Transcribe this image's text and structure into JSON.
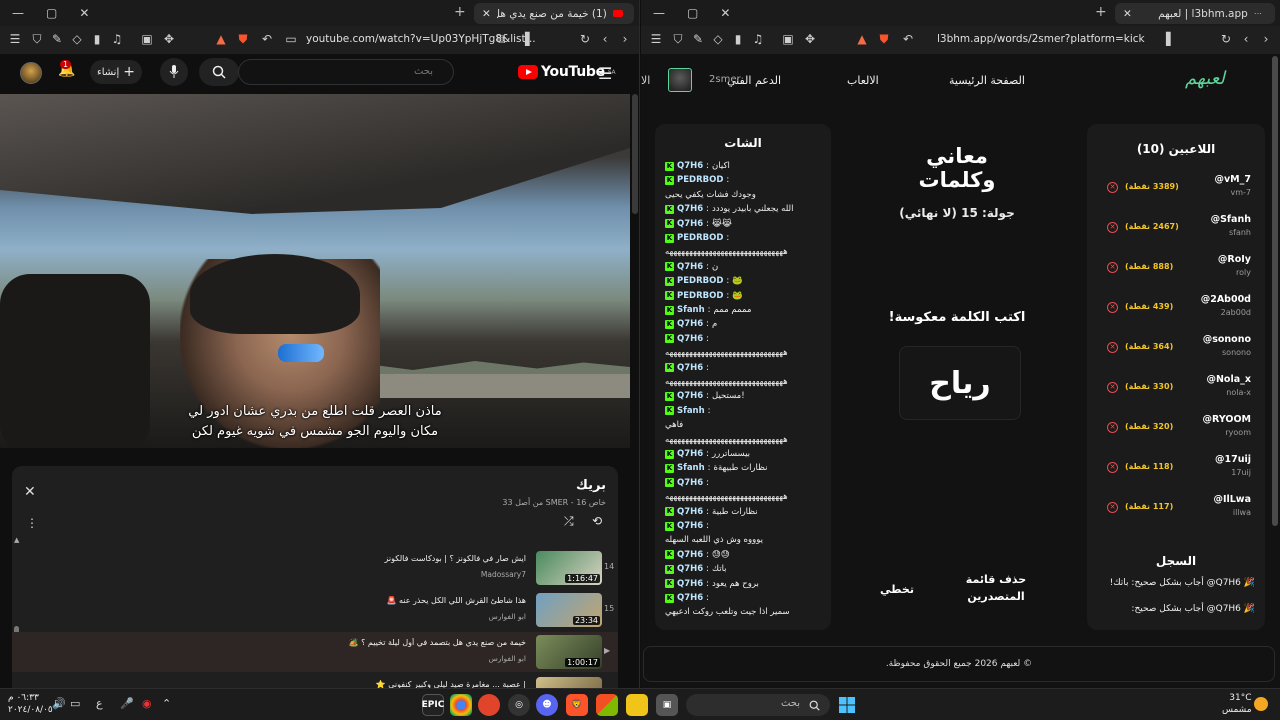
{
  "left_window": {
    "tab_title": "(1) خيمة من صنع يدي هل بتصـ...",
    "url": "youtube.com/watch?v=Up03YpHjTg8&list...",
    "youtube": {
      "logo_text": "YouTube",
      "logo_region": "SA",
      "search_placeholder": "بحث",
      "create_label": "إنشاء",
      "notification_count": "1"
    },
    "subtitles": [
      "ماذن العصر قلت اطلع من بدري عشان ادور لي",
      "مكان واليوم الجو مشمس في شويه غيوم لكن"
    ],
    "playlist": {
      "title": "بريك",
      "subtitle": "خاص SMER - 16 من أصل 33",
      "items": [
        {
          "num": "14",
          "title": "ايش صار في فالكونز ؟ | بودكاست فالكونز",
          "channel": "Madossary7",
          "duration": "1:16:47",
          "active": false
        },
        {
          "num": "15",
          "title": "هذا شاطئ القرش اللي الكل يحذر عنه 🚨",
          "channel": "ابو الفوارس",
          "duration": "23:34",
          "active": false
        },
        {
          "num": "▶",
          "title": "خيمة من صنع يدي هل بتصمد في أول ليلة تخييم ؟ 🏕️",
          "channel": "ابو الفوارس",
          "duration": "1:00:17",
          "active": true
        },
        {
          "num": "",
          "title": "| عصبة ... مغامرة صيد ليلي وكبير كنفوني ⭐",
          "channel": "",
          "duration": "",
          "active": false
        }
      ]
    }
  },
  "right_window": {
    "tab_title": "لعبهم | l3bhm.app",
    "url": "l3bhm.app/words/2smer?platform=kick",
    "site": {
      "logo": "لعبهم",
      "nav": {
        "home": "الصفحة الرئيسية",
        "games": "الالعاب",
        "support": "الدعم الفني",
        "user": "2smer",
        "cut": "الا"
      }
    },
    "chat": {
      "title": "الشات",
      "messages": [
        {
          "user": "Q7H6",
          "badge": true,
          "text": "اكيان"
        },
        {
          "user": "PEDRBOD",
          "badge": true,
          "text": ""
        },
        {
          "user": "",
          "badge": false,
          "text": "وجودك فشات يكفي يحيى"
        },
        {
          "user": "Q7H6",
          "badge": true,
          "text": "الله يجعلني بابيدر يوددد"
        },
        {
          "user": "Q7H6",
          "badge": true,
          "text": "😹😹"
        },
        {
          "user": "PEDRBOD",
          "badge": true,
          "text": ""
        },
        {
          "user": "",
          "badge": false,
          "text": "ههههههههههههههههههههههههههههههه"
        },
        {
          "user": "Q7H6",
          "badge": true,
          "text": "ن"
        },
        {
          "user": "PEDRBOD",
          "badge": true,
          "text": "🐸"
        },
        {
          "user": "PEDRBOD",
          "badge": true,
          "text": "🐸"
        },
        {
          "user": "Sfanh",
          "badge": true,
          "text": "مممم ممم"
        },
        {
          "user": "Q7H6",
          "badge": true,
          "text": "م"
        },
        {
          "user": "Q7H6",
          "badge": true,
          "text": ""
        },
        {
          "user": "",
          "badge": false,
          "text": "ههههههههههههههههههههههههههههههه"
        },
        {
          "user": "Q7H6",
          "badge": true,
          "text": ""
        },
        {
          "user": "",
          "badge": false,
          "text": "ههههههههههههههههههههههههههههههه"
        },
        {
          "user": "Q7H6",
          "badge": true,
          "text": "!مستحيل"
        },
        {
          "user": "Sfanh",
          "badge": true,
          "text": ""
        },
        {
          "user": "",
          "badge": false,
          "text": "فاهي"
        },
        {
          "user": "",
          "badge": false,
          "text": "ههههههههههههههههههههههههههههههه"
        },
        {
          "user": "Q7H6",
          "badge": true,
          "text": "بيسساتررر"
        },
        {
          "user": "Sfanh",
          "badge": true,
          "text": "نظارات طبيهةة"
        },
        {
          "user": "Q7H6",
          "badge": true,
          "text": ""
        },
        {
          "user": "",
          "badge": false,
          "text": "ههههههههههههههههههههههههههههههه"
        },
        {
          "user": "Q7H6",
          "badge": true,
          "text": "نظارات طبية"
        },
        {
          "user": "Q7H6",
          "badge": true,
          "text": ""
        },
        {
          "user": "",
          "badge": false,
          "text": "يوووه وش ذي اللعبه السهله"
        },
        {
          "user": "Q7H6",
          "badge": true,
          "text": "😓😓"
        },
        {
          "user": "Q7H6",
          "badge": true,
          "text": "باتك"
        },
        {
          "user": "Q7H6",
          "badge": true,
          "text": "بروح هم يعود"
        },
        {
          "user": "Q7H6",
          "badge": true,
          "text": ""
        },
        {
          "user": "",
          "badge": false,
          "text": "سمير اذا جيت وتلعب روكت ادعيهي"
        }
      ]
    },
    "game": {
      "title": "معاني وكلمات",
      "round": "جولة: 15 (لا نهائي)",
      "instruction": "اكتب الكلمة معكوسة!",
      "word": "رياح",
      "skip_label": "تخطي",
      "delete_leaderboard_label": "حذف قائمة المتصدرين"
    },
    "players": {
      "title": "اللاعبين (10)",
      "list": [
        {
          "name": "@vM_7",
          "sub": "vm-7",
          "points": "(3389 نقطة)"
        },
        {
          "name": "@Sfanh",
          "sub": "sfanh",
          "points": "(2467 نقطة)"
        },
        {
          "name": "@RoIy",
          "sub": "roly",
          "points": "(888 نقطة)"
        },
        {
          "name": "@2Ab00d",
          "sub": "2ab00d",
          "points": "(439 نقطة)"
        },
        {
          "name": "@sonono",
          "sub": "sonono",
          "points": "(364 نقطة)"
        },
        {
          "name": "@Nola_x",
          "sub": "nola-x",
          "points": "(330 نقطة)"
        },
        {
          "name": "@RYOOM",
          "sub": "ryoom",
          "points": "(320 نقطة)"
        },
        {
          "name": "@17uij",
          "sub": "17uij",
          "points": "(118 نقطة)"
        },
        {
          "name": "@IlLwa",
          "sub": "illwa",
          "points": "(117 نقطة)"
        }
      ]
    },
    "log": {
      "title": "السجل",
      "entries": [
        "🎉 Q7H6@ أجاب بشكل صحيح: باتك!",
        "🎉 Q7H6@ أجاب بشكل صحيح:"
      ]
    },
    "footer": "© لعبهم 2026 جميع الحقوق محفوظة."
  },
  "taskbar": {
    "search_placeholder": "بحث",
    "time": "٠٦:٣٣ م",
    "date": "٢٠٢٤/٠٨/٠٥",
    "weather_temp": "31°C",
    "weather_desc": "مشمس",
    "lang": "ع"
  },
  "colors": {
    "youtube_red": "#ff0000",
    "kick_green": "#53fc18",
    "site_logo_green": "#5fd39a",
    "points_yellow": "#f3c623",
    "remove_red": "#e05050"
  }
}
